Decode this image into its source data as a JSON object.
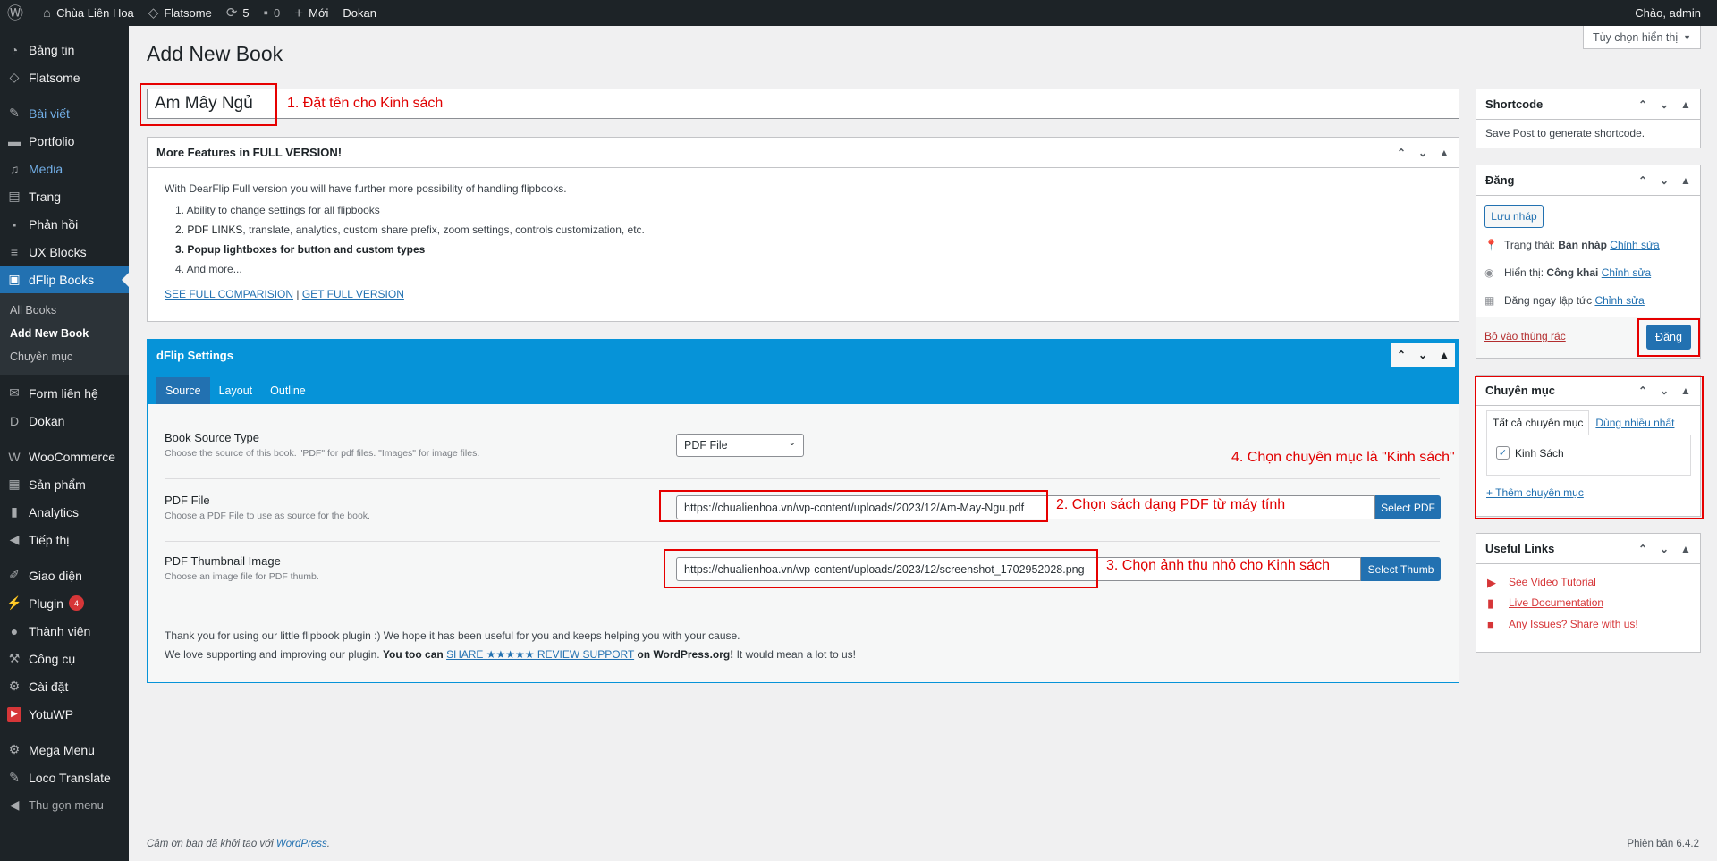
{
  "admin_bar": {
    "site_name": "Chùa Liên Hoa",
    "theme": "Flatsome",
    "updates_count": "5",
    "comments_count": "0",
    "new_label": "Mới",
    "dokan": "Dokan",
    "greeting": "Chào, admin"
  },
  "sidebar": {
    "items": [
      {
        "label": "Bảng tin",
        "icon": "dashboard-icon"
      },
      {
        "label": "Flatsome",
        "icon": "flatsome-icon"
      },
      {
        "label": "Bài viết",
        "icon": "pin-icon"
      },
      {
        "label": "Portfolio",
        "icon": "portfolio-icon"
      },
      {
        "label": "Media",
        "icon": "media-icon"
      },
      {
        "label": "Trang",
        "icon": "page-icon"
      },
      {
        "label": "Phản hồi",
        "icon": "comment-icon"
      },
      {
        "label": "UX Blocks",
        "icon": "blocks-icon"
      },
      {
        "label": "dFlip Books",
        "icon": "book-icon"
      },
      {
        "label": "Form liên hệ",
        "icon": "mail-icon"
      },
      {
        "label": "Dokan",
        "icon": "dokan-icon"
      },
      {
        "label": "WooCommerce",
        "icon": "woo-icon"
      },
      {
        "label": "Sản phẩm",
        "icon": "archive-icon"
      },
      {
        "label": "Analytics",
        "icon": "chart-icon"
      },
      {
        "label": "Tiếp thị",
        "icon": "megaphone-icon"
      },
      {
        "label": "Giao diện",
        "icon": "brush-icon"
      },
      {
        "label": "Plugin",
        "icon": "plugin-icon",
        "badge": "4"
      },
      {
        "label": "Thành viên",
        "icon": "users-icon"
      },
      {
        "label": "Công cụ",
        "icon": "tools-icon"
      },
      {
        "label": "Cài đặt",
        "icon": "settings-icon"
      },
      {
        "label": "YotuWP",
        "icon": "yotuwp-icon"
      },
      {
        "label": "Mega Menu",
        "icon": "megamenu-icon"
      },
      {
        "label": "Loco Translate",
        "icon": "translate-icon"
      },
      {
        "label": "Thu gọn menu",
        "icon": "collapse-icon"
      }
    ],
    "submenu": [
      "All Books",
      "Add New Book",
      "Chuyên mục"
    ]
  },
  "page": {
    "title": "Add New Book",
    "screen_options": "Tùy chọn hiển thị",
    "book_title": "Am Mây Ngủ"
  },
  "annotations": {
    "a1": "1. Đặt tên cho Kinh sách",
    "a2": "2. Chọn sách dạng PDF từ máy tính",
    "a3": "3. Chọn ảnh thu nhỏ cho Kinh sách",
    "a4": "4. Chọn chuyên mục là \"Kinh sách\""
  },
  "more_features": {
    "title": "More Features in FULL VERSION!",
    "intro": "With DearFlip Full version you will have further more possibility of handling flipbooks.",
    "list": [
      {
        "strong": "",
        "text": "1. Ability to change settings for all flipbooks"
      },
      {
        "strong": "2. PDF LINKS",
        "text": ", translate, analytics, custom share prefix, zoom settings, controls customization, etc."
      },
      {
        "strong": "3. Popup lightboxes for button and custom types",
        "text": ""
      },
      {
        "strong": "",
        "text": "4. And more..."
      }
    ],
    "link1": "SEE FULL COMPARISION",
    "link_sep": "|",
    "link2": "GET FULL VERSION"
  },
  "dflip": {
    "title": "dFlip Settings",
    "tabs": [
      "Source",
      "Layout",
      "Outline"
    ],
    "source_type_label": "Book Source Type",
    "source_type_desc": "Choose the source of this book. \"PDF\" for pdf files. \"Images\" for image files.",
    "source_type_value": "PDF File",
    "pdf_label": "PDF File",
    "pdf_desc": "Choose a PDF File to use as source for the book.",
    "pdf_value": "https://chualienhoa.vn/wp-content/uploads/2023/12/Am-May-Ngu.pdf",
    "pdf_button": "Select PDF",
    "thumb_label": "PDF Thumbnail Image",
    "thumb_desc": "Choose an image file for PDF thumb.",
    "thumb_value": "https://chualienhoa.vn/wp-content/uploads/2023/12/screenshot_1702952028.png",
    "thumb_button": "Select Thumb",
    "thanks1": "Thank you for using our little flipbook plugin :) We hope it has been useful for you and keeps helping you with your cause.",
    "thanks2a": "We love supporting and improving our plugin.",
    "thanks2b": "You too can",
    "thanks2c": "SHARE ★★★★★ REVIEW SUPPORT",
    "thanks2d": "on WordPress.org!",
    "thanks2e": "It would mean a lot to us!"
  },
  "shortcode": {
    "title": "Shortcode",
    "text": "Save Post to generate shortcode."
  },
  "publish": {
    "title": "Đăng",
    "save_draft": "Lưu nháp",
    "status_label": "Trạng thái:",
    "status_value": "Bản nháp",
    "visibility_label": "Hiển thị:",
    "visibility_value": "Công khai",
    "schedule_label": "Đăng ngay lập tức",
    "edit": "Chỉnh sửa",
    "trash": "Bỏ vào thùng rác",
    "publish_button": "Đăng"
  },
  "categories": {
    "title": "Chuyên mục",
    "tab_all": "Tất cả chuyên mục",
    "tab_popular": "Dùng nhiều nhất",
    "item": "Kinh Sách",
    "add": "+ Thêm chuyên mục"
  },
  "useful_links": {
    "title": "Useful Links",
    "links": [
      "See Video Tutorial",
      "Live Documentation",
      "Any Issues? Share with us!"
    ]
  },
  "footer": {
    "left_text": "Cảm ơn bạn đã khởi tạo với",
    "left_link": "WordPress",
    "left_end": ".",
    "version": "Phiên bản 6.4.2"
  }
}
